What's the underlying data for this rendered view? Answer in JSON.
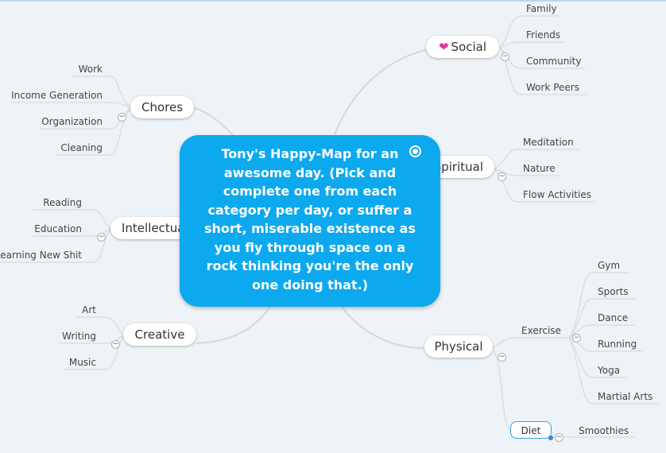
{
  "central": {
    "text": "Tony's Happy-Map for an awesome day. (Pick and complete one from each category per day, or suffer a short, miserable existence as you fly through space on a rock thinking you're the only one doing that.)",
    "color": "#0da9ef"
  },
  "topics": {
    "social": {
      "label": "Social",
      "icon": "heart-icon",
      "items": [
        "Family",
        "Friends",
        "Community",
        "Work Peers"
      ]
    },
    "spiritual": {
      "label": "Spiritual",
      "items": [
        "Meditation",
        "Nature",
        "Flow Activities"
      ]
    },
    "physical": {
      "label": "Physical",
      "exercise": {
        "label": "Exercise",
        "items": [
          "Gym",
          "Sports",
          "Dance",
          "Running",
          "Yoga",
          "Martial Arts"
        ]
      },
      "diet": {
        "label": "Diet",
        "items": [
          "Smoothies"
        ]
      }
    },
    "chores": {
      "label": "Chores",
      "items": [
        "Work",
        "Income Generation",
        "Organization",
        "Cleaning"
      ]
    },
    "intellectual": {
      "label": "Intellectual",
      "items": [
        "Reading",
        "Education",
        "Learning New Shit"
      ]
    },
    "creative": {
      "label": "Creative",
      "items": [
        "Art",
        "Writing",
        "Music"
      ]
    }
  },
  "colors": {
    "accent": "#0da9ef",
    "heart": "#e0379a",
    "line": "#cfd6dc"
  }
}
